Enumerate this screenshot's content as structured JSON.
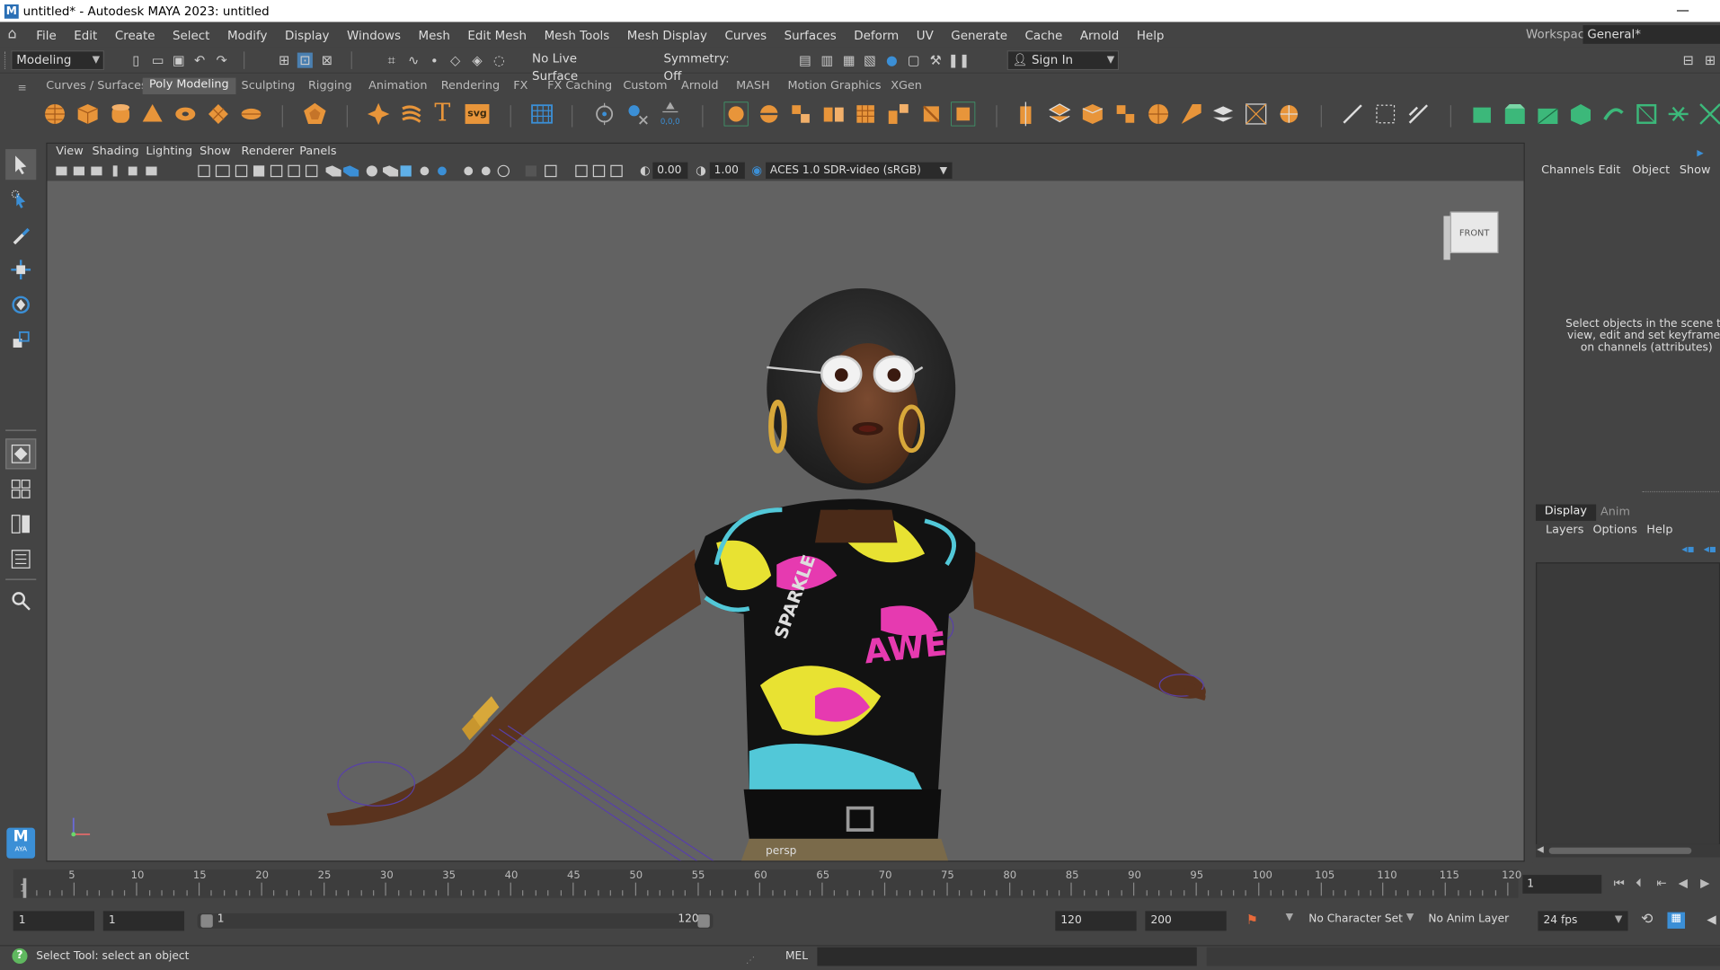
{
  "window": {
    "title": "untitled* - Autodesk MAYA 2023: untitled",
    "minimize": "—"
  },
  "menubar": {
    "items": [
      "File",
      "Edit",
      "Create",
      "Select",
      "Modify",
      "Display",
      "Windows",
      "Mesh",
      "Edit Mesh",
      "Mesh Tools",
      "Mesh Display",
      "Curves",
      "Surfaces",
      "Deform",
      "UV",
      "Generate",
      "Cache",
      "Arnold",
      "Help"
    ],
    "workspace_label": "Workspace:",
    "workspace_value": "General*"
  },
  "toolbar": {
    "mode": "Modeling",
    "live_surface": "No Live Surface",
    "symmetry": "Symmetry: Off",
    "signin": "Sign In"
  },
  "shelf": {
    "tabs": [
      "Curves / Surfaces",
      "Poly Modeling",
      "Sculpting",
      "Rigging",
      "Animation",
      "Rendering",
      "FX",
      "FX Caching",
      "Custom",
      "Arnold",
      "MASH",
      "Motion Graphics",
      "XGen"
    ],
    "active": "Poly Modeling"
  },
  "viewport": {
    "menu": [
      "View",
      "Shading",
      "Lighting",
      "Show",
      "Renderer",
      "Panels"
    ],
    "exposure": "0.00",
    "gamma": "1.00",
    "colorspace": "ACES 1.0 SDR-video (sRGB)",
    "camera_label": "persp",
    "viewcube": "FRONT",
    "shirt_text_1": "AWE",
    "shirt_text_2": "SPARKLE"
  },
  "channel_box": {
    "menu": [
      "Channels",
      "Edit",
      "Object",
      "Show"
    ],
    "message": "Select objects in the scene to view, edit and set keyframes on channels (attributes)"
  },
  "layers": {
    "tabs": [
      "Display",
      "Anim"
    ],
    "menu": [
      "Layers",
      "Options",
      "Help"
    ]
  },
  "timeline": {
    "ticks": [
      "5",
      "10",
      "15",
      "20",
      "25",
      "30",
      "35",
      "40",
      "45",
      "50",
      "55",
      "60",
      "65",
      "70",
      "75",
      "80",
      "85",
      "90",
      "95",
      "100",
      "105",
      "110",
      "115",
      "120"
    ],
    "first_tick": "1",
    "current_frame": "1"
  },
  "range": {
    "start": "1",
    "anim_start": "1",
    "slider_start": "1",
    "slider_end": "120",
    "end": "120",
    "anim_end": "200",
    "character_set": "No Character Set",
    "anim_layer": "No Anim Layer",
    "fps": "24 fps"
  },
  "status": {
    "help": "Select Tool: select an object",
    "script_lang": "MEL"
  },
  "logo": {
    "text": "M",
    "sub": "AYA"
  },
  "colors": {
    "shelf_orange": "#e8953a",
    "shelf_green": "#3cb87a",
    "viewport_bg": "#626262",
    "accent_blue": "#3b8fd6"
  }
}
